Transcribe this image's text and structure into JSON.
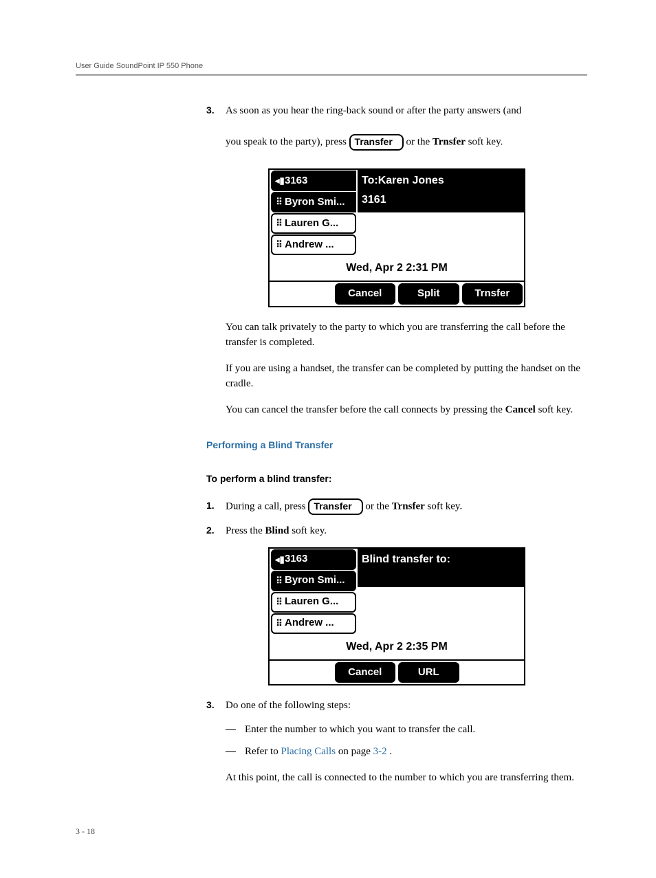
{
  "header": "User Guide SoundPoint IP 550 Phone",
  "step3": {
    "num": "3.",
    "line1a": "As soon as you hear the ring-back sound or after the party answers (and",
    "line2a": "you speak to the party), press ",
    "btn": "Transfer",
    "line2b": " or the ",
    "bold": "Trnsfer",
    "line2c": " soft key."
  },
  "screen1": {
    "ext": "3163",
    "lines": [
      "Byron Smi...",
      "Lauren G...",
      "Andrew ..."
    ],
    "header": "To:Karen Jones",
    "sub": "3161",
    "date": "Wed, Apr 2  2:31 PM",
    "softkeys": [
      "Cancel",
      "Split",
      "Trnsfer"
    ]
  },
  "para_after1a": "You can talk privately to the party to which you are transferring the call before the transfer is completed.",
  "para_after1b": "If you are using a handset, the transfer can be completed by putting the handset on the cradle.",
  "para_after1c_a": "You can cancel the transfer before the call connects by pressing the ",
  "para_after1c_bold": "Cancel",
  "para_after1c_b": " soft key.",
  "heading_blind": "Performing a Blind Transfer",
  "subheading": "To perform a blind transfer:",
  "bt_step1": {
    "num": "1.",
    "a": "During a call, press ",
    "btn": "Transfer",
    "b": " or the ",
    "bold": "Trnsfer",
    "c": " soft key."
  },
  "bt_step2": {
    "num": "2.",
    "a": "Press the ",
    "bold": "Blind",
    "b": " soft key."
  },
  "screen2": {
    "ext": "3163",
    "lines": [
      "Byron Smi...",
      "Lauren G...",
      "Andrew ..."
    ],
    "header": "Blind transfer to:",
    "date": "Wed, Apr 2  2:35 PM",
    "softkeys": [
      "Cancel",
      "URL"
    ]
  },
  "bt_step3": {
    "num": "3.",
    "text": "Do one of the following steps:"
  },
  "dash1": "Enter the number to which you want to transfer the call.",
  "dash2a": "Refer to ",
  "dash2_link": "Placing Calls",
  "dash2b": " on page ",
  "dash2_link2": "3-2",
  "dash2c": ".",
  "final_para": "At this point, the call is connected to the number to which you are transferring them.",
  "footer": "3 - 18"
}
